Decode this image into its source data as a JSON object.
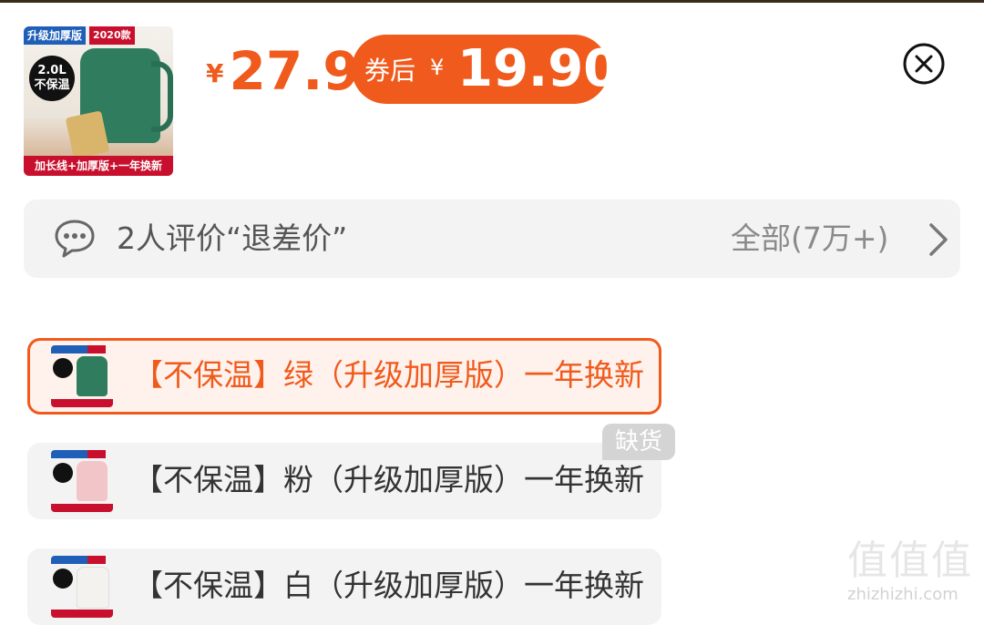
{
  "product": {
    "thumb_tag_left": "升级加厚版",
    "thumb_tag_right": "2020款",
    "thumb_badge_line1": "2.0L",
    "thumb_badge_line2": "不保温",
    "thumb_bottom": "加长线+加厚版+一年换新"
  },
  "price": {
    "currency": "¥",
    "amount": "27.9"
  },
  "coupon": {
    "label": "券后",
    "currency": "¥",
    "amount": "19.90"
  },
  "review": {
    "text": "2人评价“退差价”",
    "all_label": "全部(7万+)"
  },
  "variants": [
    {
      "label": "【不保温】绿（升级加厚版）一年换新",
      "color": "#2f7d5e",
      "selected": true
    },
    {
      "label": "【不保温】粉（升级加厚版）一年换新",
      "color": "#f2c6c8",
      "selected": false
    },
    {
      "label": "【不保温】白（升级加厚版）一年换新",
      "color": "#f4f2ef",
      "selected": false
    }
  ],
  "soldout_badge": "缺货",
  "watermark": {
    "mark": "值值值",
    "site": "zhizhizhi.com"
  },
  "colors": {
    "accent": "#f05a1c",
    "panel": "#f3f3f3"
  },
  "icons": [
    "close-icon",
    "chat-bubble-icon",
    "chevron-right-icon"
  ]
}
